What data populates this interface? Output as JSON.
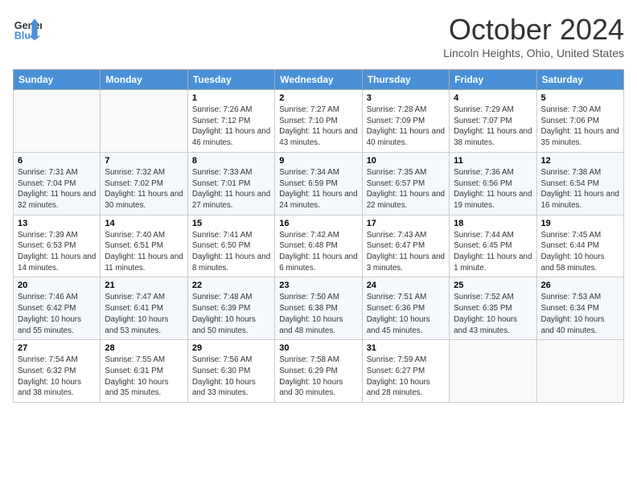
{
  "header": {
    "logo_line1": "General",
    "logo_line2": "Blue",
    "month": "October 2024",
    "location": "Lincoln Heights, Ohio, United States"
  },
  "weekdays": [
    "Sunday",
    "Monday",
    "Tuesday",
    "Wednesday",
    "Thursday",
    "Friday",
    "Saturday"
  ],
  "weeks": [
    [
      {
        "day": "",
        "info": ""
      },
      {
        "day": "",
        "info": ""
      },
      {
        "day": "1",
        "info": "Sunrise: 7:26 AM\nSunset: 7:12 PM\nDaylight: 11 hours and 46 minutes."
      },
      {
        "day": "2",
        "info": "Sunrise: 7:27 AM\nSunset: 7:10 PM\nDaylight: 11 hours and 43 minutes."
      },
      {
        "day": "3",
        "info": "Sunrise: 7:28 AM\nSunset: 7:09 PM\nDaylight: 11 hours and 40 minutes."
      },
      {
        "day": "4",
        "info": "Sunrise: 7:29 AM\nSunset: 7:07 PM\nDaylight: 11 hours and 38 minutes."
      },
      {
        "day": "5",
        "info": "Sunrise: 7:30 AM\nSunset: 7:06 PM\nDaylight: 11 hours and 35 minutes."
      }
    ],
    [
      {
        "day": "6",
        "info": "Sunrise: 7:31 AM\nSunset: 7:04 PM\nDaylight: 11 hours and 32 minutes."
      },
      {
        "day": "7",
        "info": "Sunrise: 7:32 AM\nSunset: 7:02 PM\nDaylight: 11 hours and 30 minutes."
      },
      {
        "day": "8",
        "info": "Sunrise: 7:33 AM\nSunset: 7:01 PM\nDaylight: 11 hours and 27 minutes."
      },
      {
        "day": "9",
        "info": "Sunrise: 7:34 AM\nSunset: 6:59 PM\nDaylight: 11 hours and 24 minutes."
      },
      {
        "day": "10",
        "info": "Sunrise: 7:35 AM\nSunset: 6:57 PM\nDaylight: 11 hours and 22 minutes."
      },
      {
        "day": "11",
        "info": "Sunrise: 7:36 AM\nSunset: 6:56 PM\nDaylight: 11 hours and 19 minutes."
      },
      {
        "day": "12",
        "info": "Sunrise: 7:38 AM\nSunset: 6:54 PM\nDaylight: 11 hours and 16 minutes."
      }
    ],
    [
      {
        "day": "13",
        "info": "Sunrise: 7:39 AM\nSunset: 6:53 PM\nDaylight: 11 hours and 14 minutes."
      },
      {
        "day": "14",
        "info": "Sunrise: 7:40 AM\nSunset: 6:51 PM\nDaylight: 11 hours and 11 minutes."
      },
      {
        "day": "15",
        "info": "Sunrise: 7:41 AM\nSunset: 6:50 PM\nDaylight: 11 hours and 8 minutes."
      },
      {
        "day": "16",
        "info": "Sunrise: 7:42 AM\nSunset: 6:48 PM\nDaylight: 11 hours and 6 minutes."
      },
      {
        "day": "17",
        "info": "Sunrise: 7:43 AM\nSunset: 6:47 PM\nDaylight: 11 hours and 3 minutes."
      },
      {
        "day": "18",
        "info": "Sunrise: 7:44 AM\nSunset: 6:45 PM\nDaylight: 11 hours and 1 minute."
      },
      {
        "day": "19",
        "info": "Sunrise: 7:45 AM\nSunset: 6:44 PM\nDaylight: 10 hours and 58 minutes."
      }
    ],
    [
      {
        "day": "20",
        "info": "Sunrise: 7:46 AM\nSunset: 6:42 PM\nDaylight: 10 hours and 55 minutes."
      },
      {
        "day": "21",
        "info": "Sunrise: 7:47 AM\nSunset: 6:41 PM\nDaylight: 10 hours and 53 minutes."
      },
      {
        "day": "22",
        "info": "Sunrise: 7:48 AM\nSunset: 6:39 PM\nDaylight: 10 hours and 50 minutes."
      },
      {
        "day": "23",
        "info": "Sunrise: 7:50 AM\nSunset: 6:38 PM\nDaylight: 10 hours and 48 minutes."
      },
      {
        "day": "24",
        "info": "Sunrise: 7:51 AM\nSunset: 6:36 PM\nDaylight: 10 hours and 45 minutes."
      },
      {
        "day": "25",
        "info": "Sunrise: 7:52 AM\nSunset: 6:35 PM\nDaylight: 10 hours and 43 minutes."
      },
      {
        "day": "26",
        "info": "Sunrise: 7:53 AM\nSunset: 6:34 PM\nDaylight: 10 hours and 40 minutes."
      }
    ],
    [
      {
        "day": "27",
        "info": "Sunrise: 7:54 AM\nSunset: 6:32 PM\nDaylight: 10 hours and 38 minutes."
      },
      {
        "day": "28",
        "info": "Sunrise: 7:55 AM\nSunset: 6:31 PM\nDaylight: 10 hours and 35 minutes."
      },
      {
        "day": "29",
        "info": "Sunrise: 7:56 AM\nSunset: 6:30 PM\nDaylight: 10 hours and 33 minutes."
      },
      {
        "day": "30",
        "info": "Sunrise: 7:58 AM\nSunset: 6:29 PM\nDaylight: 10 hours and 30 minutes."
      },
      {
        "day": "31",
        "info": "Sunrise: 7:59 AM\nSunset: 6:27 PM\nDaylight: 10 hours and 28 minutes."
      },
      {
        "day": "",
        "info": ""
      },
      {
        "day": "",
        "info": ""
      }
    ]
  ]
}
